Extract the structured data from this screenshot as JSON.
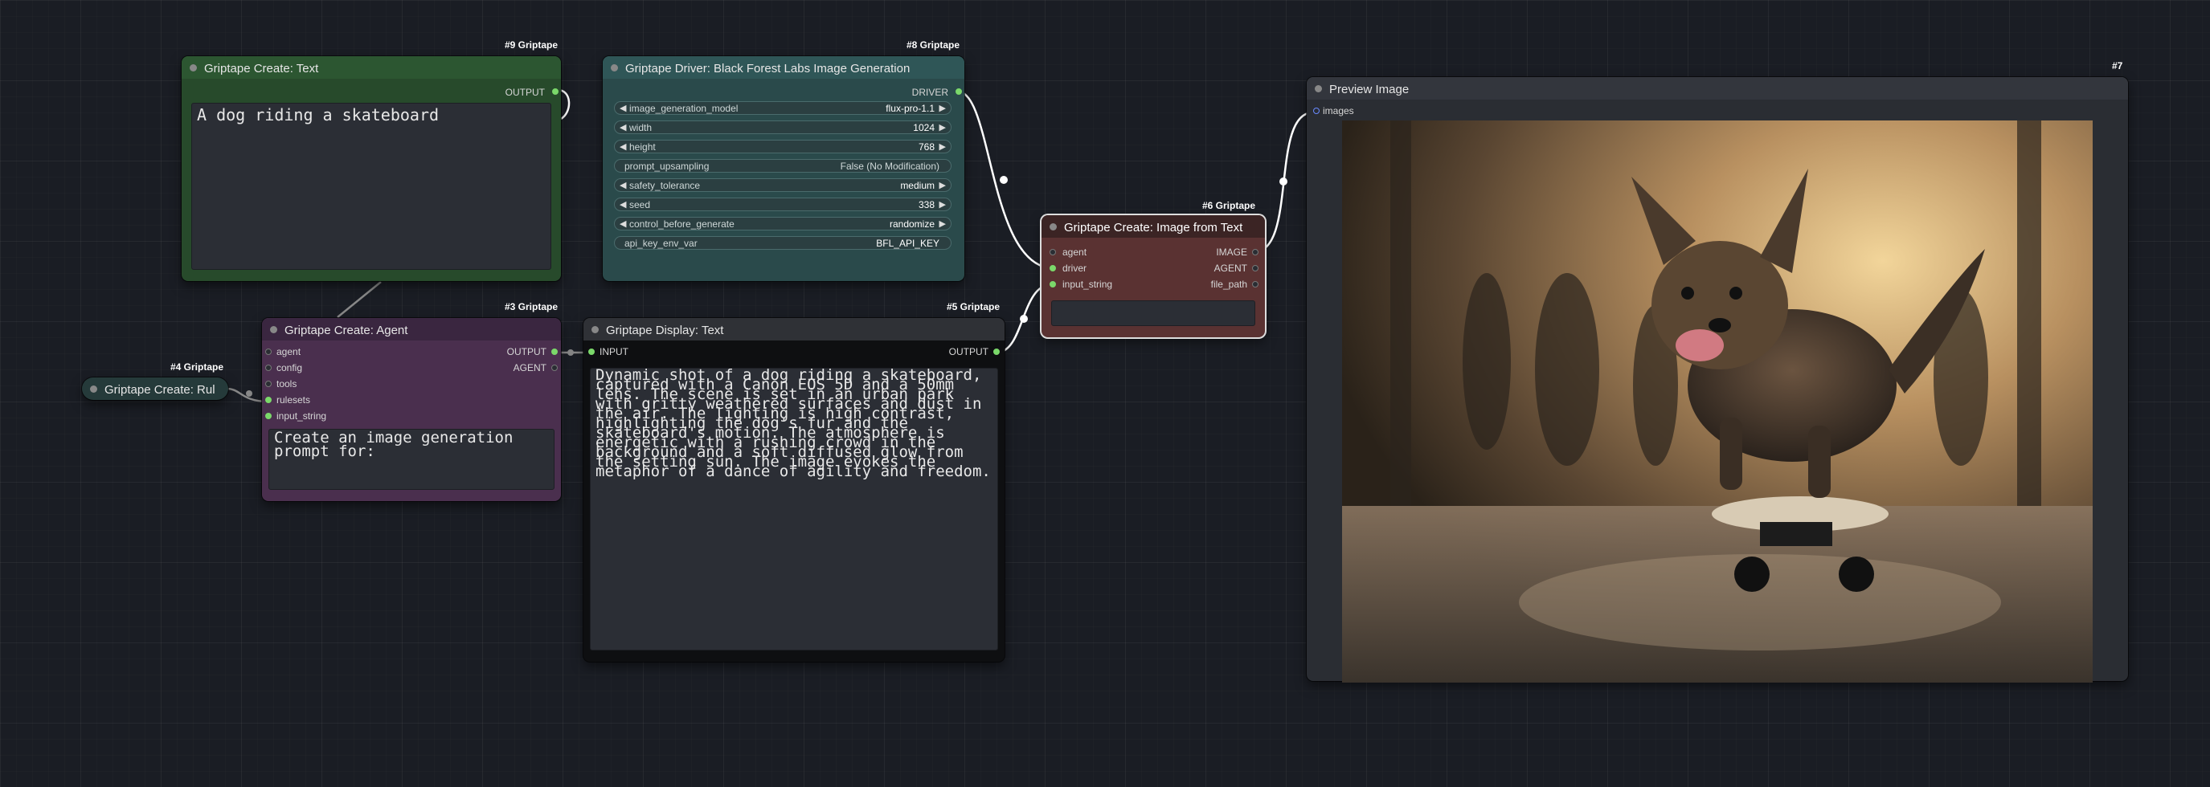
{
  "colors": {
    "canvas": "#1a1d24",
    "text_node": "#274a2b",
    "driver_node": "#2a4a4b",
    "agent_node": "#4a2f4e",
    "image_text_node": "#5a3232",
    "display_node": "#0e0f11",
    "preview_node": "#2a2d33",
    "wire": "#ffffff",
    "pin_active": "#7bd86a"
  },
  "nodes": {
    "text": {
      "badge": "#9 Griptape",
      "title": "Griptape Create: Text",
      "output_label": "OUTPUT",
      "text": "A dog riding a skateboard"
    },
    "driver": {
      "badge": "#8 Griptape",
      "title": "Griptape Driver: Black Forest Labs Image Generation",
      "output_label": "DRIVER",
      "widgets": [
        {
          "label": "image_generation_model",
          "value": "flux-pro-1.1",
          "arrows": true
        },
        {
          "label": "width",
          "value": "1024",
          "arrows": true
        },
        {
          "label": "height",
          "value": "768",
          "arrows": true
        },
        {
          "label": "prompt_upsampling",
          "value": "False (No Modification)",
          "arrows": false
        },
        {
          "label": "safety_tolerance",
          "value": "medium",
          "arrows": true
        },
        {
          "label": "seed",
          "value": "338",
          "arrows": true
        },
        {
          "label": "control_before_generate",
          "value": "randomize",
          "arrows": true
        },
        {
          "label": "api_key_env_var",
          "value": "BFL_API_KEY",
          "arrows": false
        }
      ]
    },
    "image_from_text": {
      "badge": "#6 Griptape",
      "title": "Griptape Create: Image from Text",
      "inputs": [
        "agent",
        "driver",
        "input_string"
      ],
      "outputs": [
        "IMAGE",
        "AGENT",
        "file_path"
      ]
    },
    "preview": {
      "badge": "#7",
      "title": "Preview Image",
      "input_label": "images"
    },
    "agent": {
      "badge": "#3 Griptape",
      "title": "Griptape Create: Agent",
      "inputs": [
        "agent",
        "config",
        "tools",
        "rulesets",
        "input_string"
      ],
      "outputs": [
        "OUTPUT",
        "AGENT"
      ],
      "text": "Create an image generation\nprompt for:"
    },
    "display": {
      "badge": "#5 Griptape",
      "title": "Griptape Display: Text",
      "input_label": "INPUT",
      "output_label": "OUTPUT",
      "text": "Dynamic shot of a dog riding a skateboard, captured with a Canon EOS 5D and a 50mm lens. The scene is set in an urban park with gritty weathered surfaces and dust in the air. The lighting is high contrast, highlighting the dog's fur and the skateboard's motion. The atmosphere is energetic with a rushing crowd in the background and a soft diffused glow from the setting sun. The image evokes the metaphor of a dance of agility and freedom."
    },
    "rules": {
      "badge": "#4 Griptape",
      "title": "Griptape Create: Rul"
    }
  }
}
